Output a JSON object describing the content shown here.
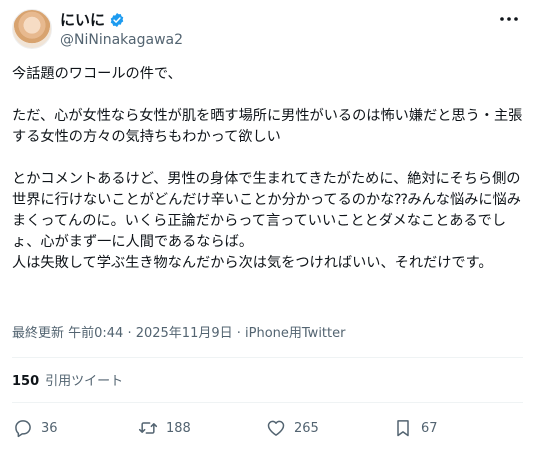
{
  "user": {
    "display_name": "にいに",
    "handle": "@NiNinakagawa2",
    "avatar_icon": "profile-avatar",
    "verified_icon": "verified-badge-icon",
    "verified_color": "#1d9bf0"
  },
  "tweet": {
    "text": "今話題のワコールの件で、\n\nただ、心が女性なら女性が肌を晒す場所に男性がいるのは怖い嫌だと思う・主張する女性の方々の気持ちもわかって欲しい\n\nとかコメントあるけど、男性の身体で生まれてきたがために、絶対にそちら側の世界に行けないことがどんだけ辛いことか分かってるのかな⁇みんな悩みに悩みまくってんのに。いくら正論だからって言っていいこととダメなことあるでしょ、心がまず一に人間であるならば。\n人は失敗して学ぶ生き物なんだから次は気をつければいい、それだけです。",
    "meta": "最終更新 午前0:44 · 2025年11月9日 · iPhone用Twitter"
  },
  "quotes": {
    "count": "150",
    "label": "引用ツイート"
  },
  "actions": {
    "reply": {
      "icon": "reply-icon",
      "count": "36"
    },
    "retweet": {
      "icon": "retweet-icon",
      "count": "188"
    },
    "like": {
      "icon": "heart-icon",
      "count": "265"
    },
    "bookmark": {
      "icon": "bookmark-icon",
      "count": "67"
    }
  }
}
